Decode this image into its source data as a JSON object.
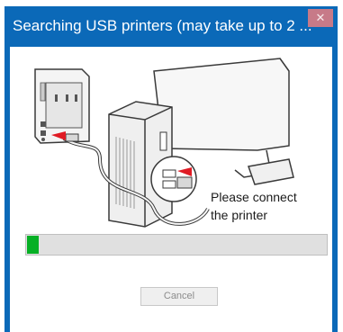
{
  "window": {
    "title": "Searching USB printers (may take up to 2 ...",
    "close_glyph": "✕",
    "accent_color": "#0b69b8"
  },
  "illustration": {
    "icons": [
      "receipt-printer-icon",
      "computer-tower-icon",
      "monitor-icon",
      "usb-cable-icon",
      "usb-port-zoom-icon"
    ]
  },
  "instruction": {
    "line1": "Please connect",
    "line2": "the printer"
  },
  "progress": {
    "fraction": 0.04,
    "fill_color": "#06b025"
  },
  "actions": {
    "cancel_label": "Cancel"
  }
}
